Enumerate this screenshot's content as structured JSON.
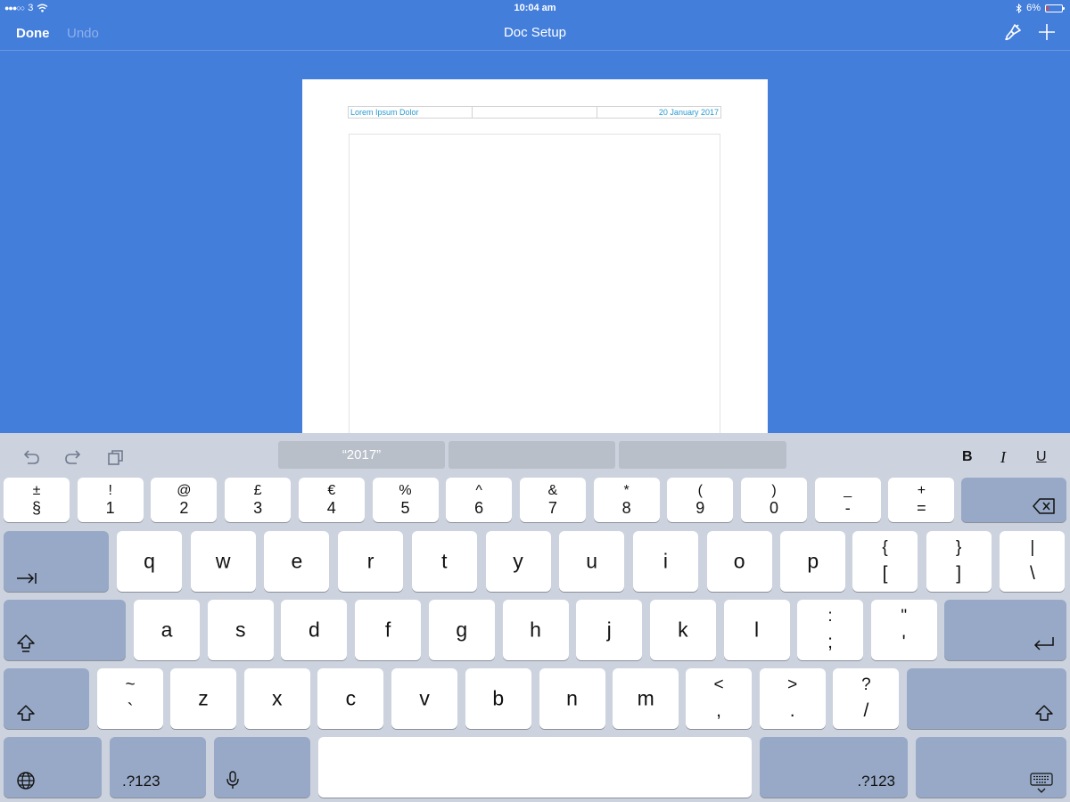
{
  "status_bar": {
    "carrier": "3",
    "time": "10:04 am",
    "battery": "6%"
  },
  "nav": {
    "done_label": "Done",
    "undo_label": "Undo",
    "title": "Doc Setup"
  },
  "document": {
    "header_left": "Lorem Ipsum Dolor",
    "header_middle": "",
    "header_right": "20 January 2017"
  },
  "keyboard": {
    "suggestions": [
      "“2017”",
      "",
      ""
    ],
    "format": {
      "bold": "B",
      "italic": "I",
      "underline": "U"
    },
    "row_numbers": [
      {
        "top": "±",
        "bottom": "§"
      },
      {
        "top": "!",
        "bottom": "1"
      },
      {
        "top": "@",
        "bottom": "2"
      },
      {
        "top": "£",
        "bottom": "3"
      },
      {
        "top": "€",
        "bottom": "4"
      },
      {
        "top": "%",
        "bottom": "5"
      },
      {
        "top": "^",
        "bottom": "6"
      },
      {
        "top": "&",
        "bottom": "7"
      },
      {
        "top": "*",
        "bottom": "8"
      },
      {
        "top": "(",
        "bottom": "9"
      },
      {
        "top": ")",
        "bottom": "0"
      },
      {
        "top": "_",
        "bottom": "-"
      },
      {
        "top": "+",
        "bottom": "="
      }
    ],
    "row_q": [
      "q",
      "w",
      "e",
      "r",
      "t",
      "y",
      "u",
      "i",
      "o",
      "p"
    ],
    "row_q_pairs": [
      {
        "top": "{",
        "bottom": "["
      },
      {
        "top": "}",
        "bottom": "]"
      },
      {
        "top": "|",
        "bottom": "\\"
      }
    ],
    "row_a": [
      "a",
      "s",
      "d",
      "f",
      "g",
      "h",
      "j",
      "k",
      "l"
    ],
    "row_a_pairs": [
      {
        "top": ":",
        "bottom": ";"
      },
      {
        "top": "\"",
        "bottom": "'"
      }
    ],
    "row_z_pre": {
      "top": "~",
      "bottom": "`"
    },
    "row_z": [
      "z",
      "x",
      "c",
      "v",
      "b",
      "n",
      "m"
    ],
    "row_z_pairs": [
      {
        "top": "<",
        "bottom": ","
      },
      {
        "top": ">",
        "bottom": "."
      },
      {
        "top": "?",
        "bottom": "/"
      }
    ],
    "numbers_label": ".?123"
  },
  "colors": {
    "accent": "#437edb",
    "header_text": "#2a9bd1"
  }
}
